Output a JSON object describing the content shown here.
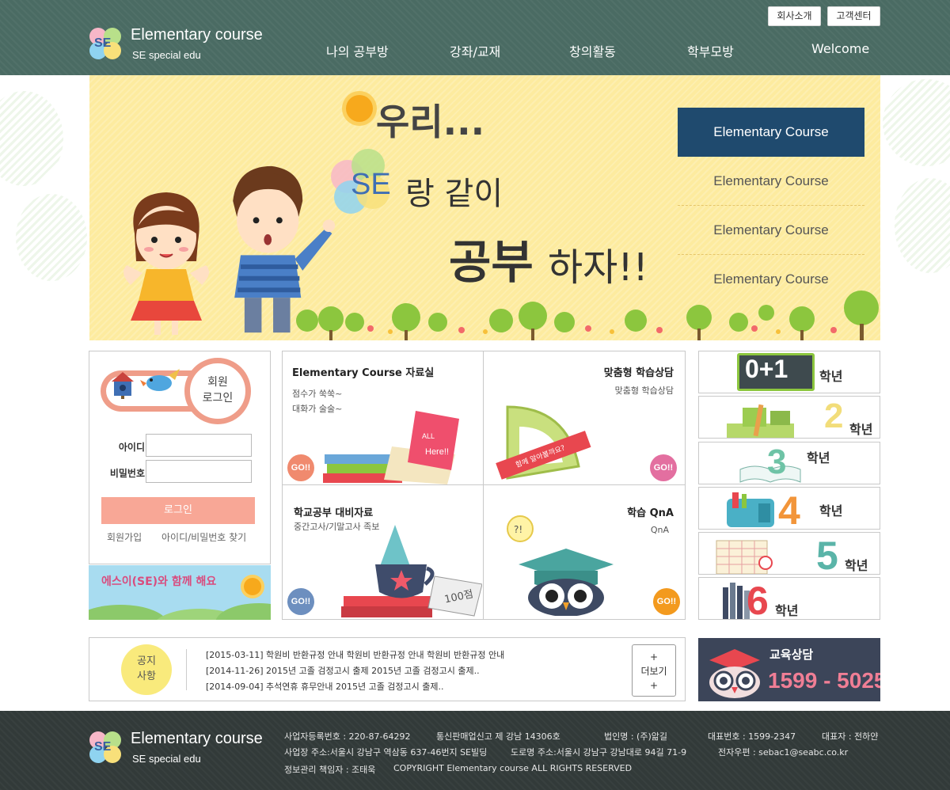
{
  "header": {
    "logo": {
      "title": "Elementary course",
      "subtitle": "SE special edu",
      "mark": "SE"
    },
    "top_buttons": {
      "company": "회사소개",
      "customer_center": "고객센터"
    },
    "nav": [
      "나의 공부방",
      "강좌/교재",
      "창의활동",
      "학부모방",
      "Welcome"
    ]
  },
  "banner": {
    "headline_line1": "우리...",
    "headline_se": "SE",
    "headline_line2": "랑 같이",
    "headline_line3a": "공부",
    "headline_line3b": "하자!!",
    "tabs": [
      "Elementary Course",
      "Elementary Course",
      "Elementary Course",
      "Elementary Course"
    ],
    "active_tab_index": 0
  },
  "login": {
    "title_line1": "회원",
    "title_line2": "로그인",
    "id_label": "아이디",
    "pw_label": "비밀번호",
    "id_value": "",
    "pw_value": "",
    "button": "로그인",
    "join_link": "회원가입",
    "find_link": "아이디/비밀번호 찾기"
  },
  "promo": {
    "text": "에스이(SE)와 함께 해요"
  },
  "cards": [
    {
      "title": "Elementary Course 자료실",
      "desc1": "점수가 쑥쑥~",
      "desc2": "대화가 술술~",
      "go": "GO!!"
    },
    {
      "title": "맞춤형 학습상담",
      "desc1": "맞춤형 학습상담",
      "desc2": "",
      "go": "GO!!",
      "badge": "함께 알아볼까요?"
    },
    {
      "title": "학교공부 대비자료",
      "desc1": "중간고사/기말고사 족보",
      "desc2": "",
      "go": "GO!!",
      "score": "100점"
    },
    {
      "title": "학습 QnA",
      "desc1": "QnA",
      "desc2": "",
      "go": "GO!!"
    }
  ],
  "grades": [
    {
      "num": "0+1",
      "label": "학년"
    },
    {
      "num": "2",
      "label": "학년"
    },
    {
      "num": "3",
      "label": "학년"
    },
    {
      "num": "4",
      "label": "학년"
    },
    {
      "num": "5",
      "label": "학년"
    },
    {
      "num": "6",
      "label": "학년"
    }
  ],
  "notice": {
    "badge_line1": "공지",
    "badge_line2": "사항",
    "items": [
      "[2015-03-11] 학원비 반환규정 안내 학원비 반환규정 안내 학원비 반환규정 안내",
      "[2014-11-26] 2015년 고졸 검정고시 출제 2015년 고졸 검정고시 출제..",
      "[2014-09-04] 추석연휴 휴무안내 2015년 고졸 검정고시 출제.."
    ],
    "more_plus": "+",
    "more_label": "더보기"
  },
  "consult": {
    "title": "교육상담",
    "phone": "1599 - 5025"
  },
  "footer": {
    "logo_title": "Elementary course",
    "logo_subtitle": "SE special edu",
    "biz_no": "사업자등록번호 : 220-87-64292",
    "mail_order": "통신판매업신고 제 강남 14306호",
    "corp_name": "법인명 : (주)앎길",
    "rep_phone": "대표번호 : 1599-2347",
    "ceo": "대표자 : 전하얀",
    "address": "사업장 주소:서울시 강남구 역삼동 637-46번지 SE빌딩",
    "road_address": "도로명 주소:서울시 강남구 강남대로 94길 71-9",
    "email": "전자우편 : sebac1@seabc.co.kr",
    "privacy_officer": "정보관리 책임자 : 조태욱",
    "copyright": "COPYRIGHT  Elementary course   ALL RIGHTS RESERVED"
  },
  "colors": {
    "header_bg": "#4a6b63",
    "banner_bg": "#fdeb9f",
    "active_tab": "#1f4a6e",
    "login_accent": "#f8a796",
    "go_red": "#f08a6e",
    "go_pink": "#e36fa0",
    "go_blue": "#6d8fbf",
    "go_orange": "#f39a1e",
    "consult_bg": "#3c4559",
    "consult_phone": "#f07e95",
    "footer_bg": "#323a39"
  }
}
